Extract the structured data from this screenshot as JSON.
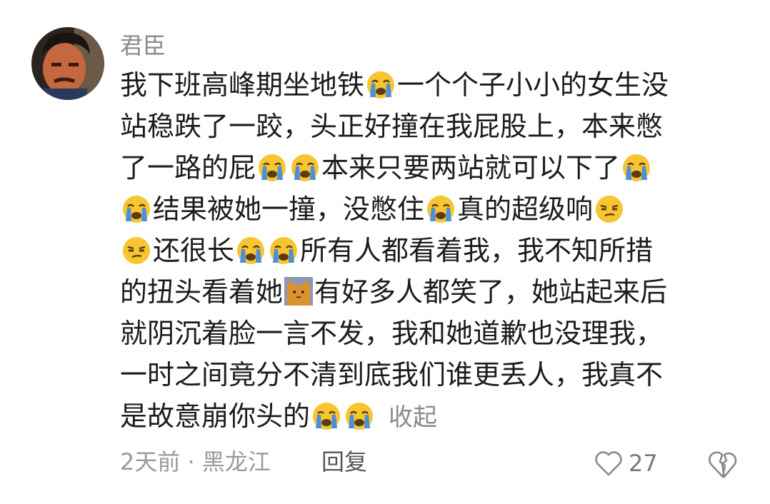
{
  "comment": {
    "username": "君臣",
    "lines": [
      [
        "我下班高峰期坐地铁",
        "[crying]",
        "一个个子小小的女生没"
      ],
      [
        "站稳跌了一跤，头正好撞在我屁股上，本来憋"
      ],
      [
        "了一路的屁",
        "[crying]",
        "[crying]",
        "本来只要两站就可以下了",
        "[crying]"
      ],
      [
        "[crying]",
        "结果被她一撞，没憋住",
        "[crying]",
        "真的超级响",
        "[smirk]"
      ],
      [
        "[smirk]",
        "还很长",
        "[crying]",
        "[crying]",
        "所有人都看着我，我不知所措"
      ],
      [
        "的扭头看着她",
        "[cat]",
        "有好多人都笑了，她站起来后"
      ],
      [
        "就阴沉着脸一言不发，我和她道歉也没理我，"
      ],
      [
        "一时之间竟分不清到底我们谁更丢人，我真不"
      ],
      [
        "是故意崩你头的",
        "[crying]",
        "[crying]"
      ]
    ],
    "collapse_label": "收起",
    "meta": "2天前 · 黑龙江",
    "reply_label": "回复",
    "like_count": "27"
  },
  "icons": {
    "crying": "crying-face-emoji",
    "smirk": "unamused-face-emoji",
    "cat": "cat-sticker",
    "like": "heart-outline-icon",
    "dislike": "broken-heart-icon"
  },
  "colors": {
    "username": "#8a8a8a",
    "text": "#1c1c1c",
    "meta": "#9a9a9a",
    "emoji_yellow": "#f7c531",
    "tear_blue": "#4a8fd8"
  }
}
